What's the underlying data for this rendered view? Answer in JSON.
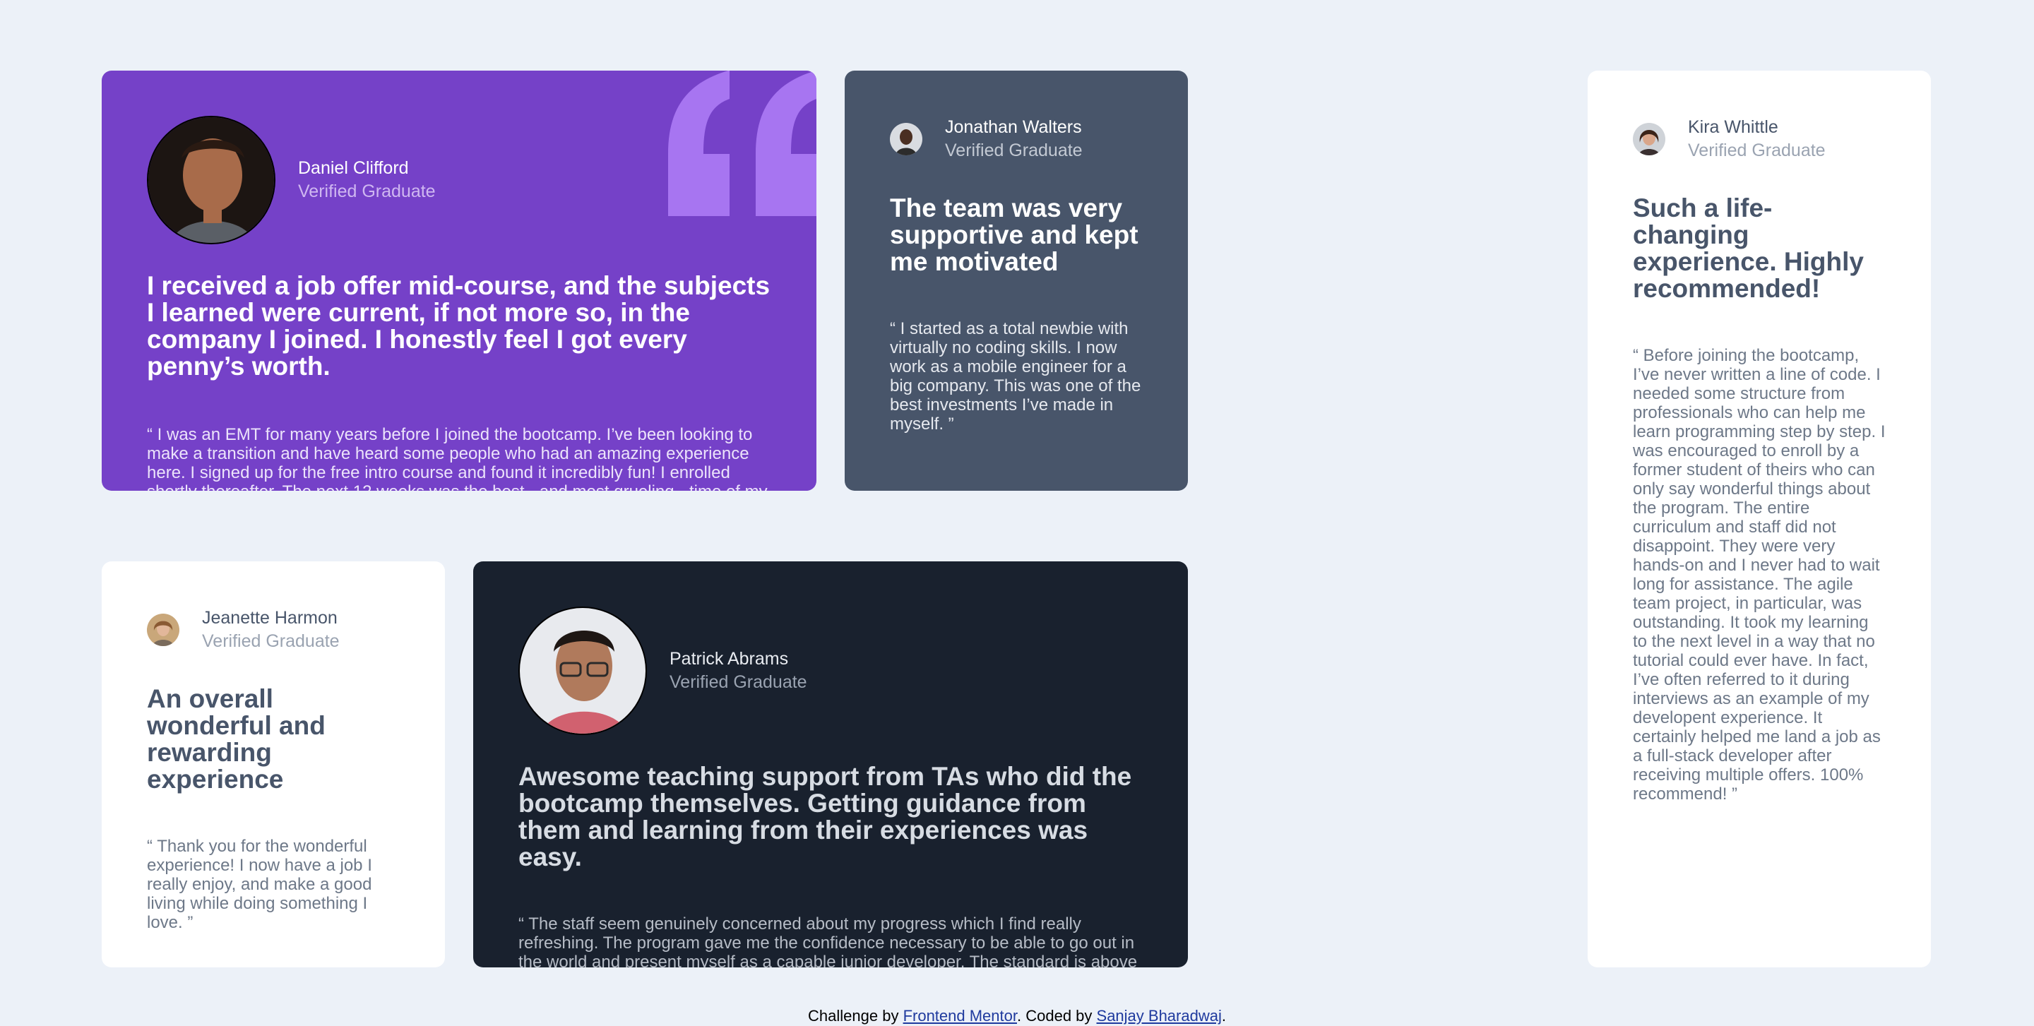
{
  "page": {
    "background": "#ecf1f8"
  },
  "testimonials": [
    {
      "name": "Daniel Clifford",
      "role": "Verified Graduate",
      "headline": "I received a job offer mid-course, and the subjects I learned were current, if not more so, in the company I joined. I honestly feel I got every penny’s worth.",
      "quote": "“ I was an EMT for many years before I joined the bootcamp. I’ve been looking to make a transition and have heard some people who had an amazing experience here. I signed up for the free intro course and found it incredibly fun! I enrolled shortly thereafter. The next 12 weeks was the best - and most grueling - time of my life. Since completing the course, I’ve successfully switched careers, working as a Software Engineer at a VR startup. ”",
      "color": "#7541c8"
    },
    {
      "name": "Jonathan Walters",
      "role": "Verified Graduate",
      "headline": "The team was very supportive and kept me motivated",
      "quote": "“ I started as a total newbie with virtually no coding skills. I now work as a mobile engineer for a big company. This was one of the best investments I’ve made in myself. ”",
      "color": "#48556a"
    },
    {
      "name": "Jeanette Harmon",
      "role": "Verified Graduate",
      "headline": "An overall wonderful and rewarding experience",
      "quote": "“ Thank you for the wonderful experience! I now have a job I really enjoy, and make a good living while doing something I love. ”",
      "color": "#ffffff"
    },
    {
      "name": "Patrick Abrams",
      "role": "Verified Graduate",
      "headline": "Awesome teaching support from TAs who did the bootcamp themselves. Getting guidance from them and learning from their experiences was easy.",
      "quote": "“ The staff seem genuinely concerned about my progress which I find really refreshing. The program gave me the confidence necessary to be able to go out in the world and present myself as a capable junior developer. The standard is above the rest. You will get the personal attention you need from an incredible community of smart and amazing people. ”",
      "color": "#19212e"
    },
    {
      "name": "Kira Whittle",
      "role": "Verified Graduate",
      "headline": "Such a life-changing experience. Highly recommended!",
      "quote": "“ Before joining the bootcamp, I’ve never written a line of code. I needed some structure from professionals who can help me learn programming step by step. I was encouraged to enroll by a former student of theirs who can only say wonderful things about the program. The entire curriculum and staff did not disappoint. They were very hands-on and I never had to wait long for assistance. The agile team project, in particular, was outstanding. It took my learning to the next level in a way that no tutorial could ever have. In fact, I’ve often referred to it during interviews as an example of my developent experience. It certainly helped me land a job as a full-stack developer after receiving multiple offers. 100% recommend! ”",
      "color": "#ffffff"
    }
  ],
  "footer": {
    "prefix": "Challenge by ",
    "link1": "Frontend Mentor",
    "middle": ". Coded by ",
    "link2": "Sanjay Bharadwaj",
    "suffix": "."
  }
}
